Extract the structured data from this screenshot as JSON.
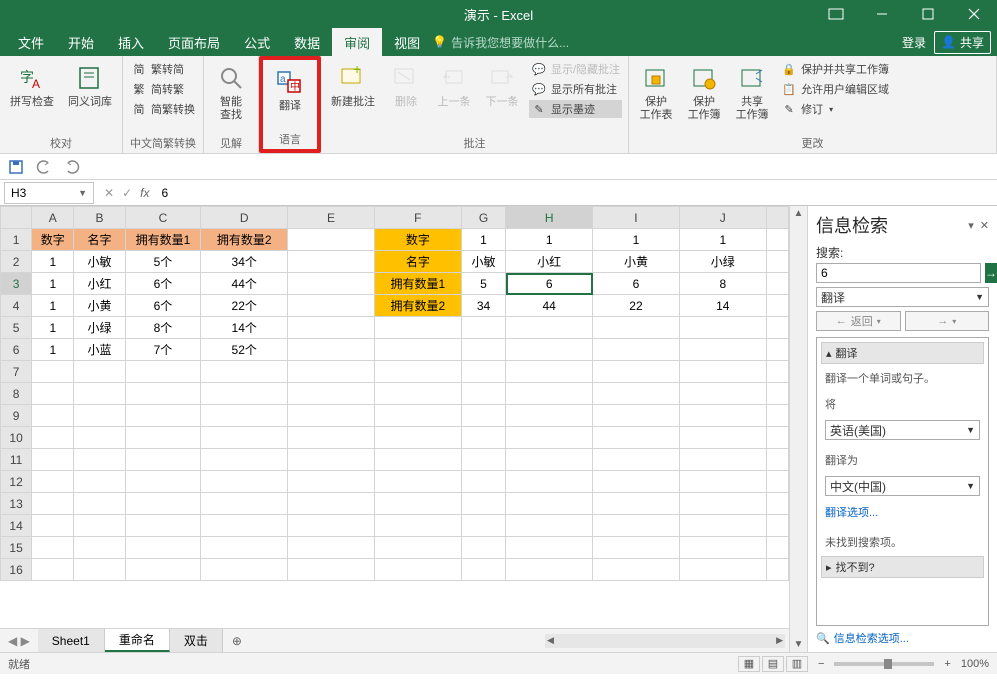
{
  "title": "演示 - Excel",
  "menu": {
    "file": "文件",
    "home": "开始",
    "insert": "插入",
    "layout": "页面布局",
    "formula": "公式",
    "data": "数据",
    "review": "审阅",
    "view": "视图",
    "tellme": "告诉我您想要做什么...",
    "login": "登录",
    "share": "共享"
  },
  "ribbon": {
    "proofing": {
      "spellcheck": "拼写检查",
      "thesaurus": "同义词库",
      "label": "校对"
    },
    "chinese": {
      "s2t": "繁转简",
      "t2s": "简转繁",
      "convert": "简繁转换",
      "label": "中文简繁转换"
    },
    "insights": {
      "smart": "智能\n查找",
      "label": "见解"
    },
    "language": {
      "translate": "翻译",
      "label": "语言"
    },
    "comments": {
      "new": "新建批注",
      "delete": "删除",
      "prev": "上一条",
      "next": "下一条",
      "showhide": "显示/隐藏批注",
      "showall": "显示所有批注",
      "ink": "显示墨迹",
      "label": "批注"
    },
    "changes": {
      "protectws": "保护\n工作表",
      "protectwb": "保护\n工作簿",
      "sharewb": "共享\n工作簿",
      "protectshare": "保护并共享工作簿",
      "allowedit": "允许用户编辑区域",
      "track": "修订",
      "label": "更改"
    }
  },
  "qat": {
    "save": "",
    "undo": "",
    "redo": ""
  },
  "namebox": "H3",
  "formula_value": "6",
  "columns": [
    "A",
    "B",
    "C",
    "D",
    "E",
    "F",
    "G",
    "H",
    "I",
    "J"
  ],
  "row_headers": [
    1,
    2,
    3,
    4,
    5,
    6,
    7,
    8,
    9,
    10,
    11,
    12,
    13,
    14,
    15,
    16
  ],
  "cells": {
    "A1": "数字",
    "B1": "名字",
    "C1": "拥有数量1",
    "D1": "拥有数量2",
    "A2": "1",
    "B2": "小敏",
    "C2": "5个",
    "D2": "34个",
    "A3": "1",
    "B3": "小红",
    "C3": "6个",
    "D3": "44个",
    "A4": "1",
    "B4": "小黄",
    "C4": "6个",
    "D4": "22个",
    "A5": "1",
    "B5": "小绿",
    "C5": "8个",
    "D5": "14个",
    "A6": "1",
    "B6": "小蓝",
    "C6": "7个",
    "D6": "52个",
    "F1": "数字",
    "G1": "1",
    "H1": "1",
    "I1": "1",
    "J1": "1",
    "F2": "名字",
    "G2": "小敏",
    "H2": "小红",
    "I2": "小黄",
    "J2": "小绿",
    "F3": "拥有数量1",
    "G3": "5",
    "H3": "6",
    "I3": "6",
    "J3": "8",
    "F4": "拥有数量2",
    "G4": "34",
    "H4": "44",
    "I4": "22",
    "J4": "14"
  },
  "sheets": {
    "sheet1": "Sheet1",
    "sheet2": "重命名",
    "sheet3": "双击"
  },
  "status": {
    "ready": "就绪",
    "zoom": "100%"
  },
  "research": {
    "title": "信息检索",
    "search_label": "搜索:",
    "search_value": "6",
    "translate_select": "翻译",
    "back": "返回",
    "section_translate": "翻译",
    "translate_hint": "翻译一个单词或句子。",
    "from_label": "将",
    "from_value": "英语(美国)",
    "to_label": "翻译为",
    "to_value": "中文(中国)",
    "options_link": "翻译选项...",
    "noresult": "未找到搜索项。",
    "cantfind": "找不到?",
    "footer_link": "信息检索选项..."
  }
}
